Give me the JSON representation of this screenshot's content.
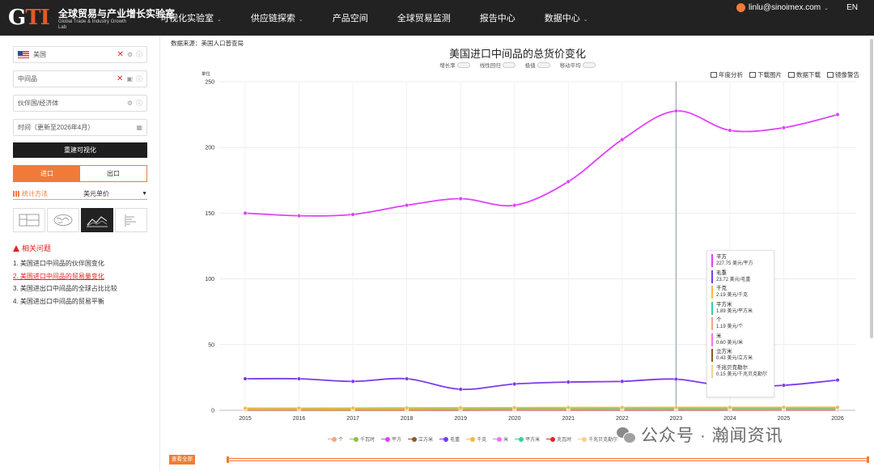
{
  "brand": {
    "mark": "GTI",
    "name_cn": "全球贸易与产业增长实验室",
    "name_en": "Global Trade & Industry Growth Lab"
  },
  "nav": [
    {
      "label": "可视化实验室",
      "caret": true
    },
    {
      "label": "供应链探索",
      "caret": true
    },
    {
      "label": "产品空间",
      "caret": false
    },
    {
      "label": "全球贸易监测",
      "caret": false
    },
    {
      "label": "报告中心",
      "caret": false
    },
    {
      "label": "数据中心",
      "caret": true
    }
  ],
  "user": {
    "email": "linlu@sinoimex.com",
    "lang": "EN"
  },
  "sidebar": {
    "country": "美国",
    "product": "中间品",
    "partner": "伙伴国/经济体",
    "time": "时间（更新至2026年4月）",
    "rebuild_label": "重建可视化",
    "trade_modes": [
      "进口",
      "出口"
    ],
    "stat_label": "统计方法",
    "stat_value": "美元单价",
    "related_title": "相关问题",
    "related": [
      "1. 美国进口中间品的伙伴国变化",
      "2. 美国进口中间品的贸易量变化",
      "3. 美国进出口中间品的全球占比比较",
      "4. 美国进出口中间品的贸易平衡"
    ],
    "related_highlight_index": 1
  },
  "main": {
    "source": "数据来源：美国人口普查局",
    "toggles": [
      "增长率",
      "线性回归",
      "极值",
      "移动平均"
    ],
    "tools": [
      "年度分析",
      "下载图片",
      "数据下载",
      "镜像警告"
    ],
    "view_all": "查看全部"
  },
  "tooltip": [
    {
      "name": "平方",
      "value": "227.75 美元/平方",
      "color": "#e040fb"
    },
    {
      "name": "毛重",
      "value": "23.72 美元/毛重",
      "color": "#7c3aed"
    },
    {
      "name": "千克",
      "value": "2.19 美元/千克",
      "color": "#f5b942"
    },
    {
      "name": "平方米",
      "value": "1.89 美元/平方米",
      "color": "#34d399"
    },
    {
      "name": "个",
      "value": "1.19 美元/个",
      "color": "#f4a582"
    },
    {
      "name": "米",
      "value": "0.60 美元/米",
      "color": "#f472f6"
    },
    {
      "name": "立方米",
      "value": "0.43 美元/立方米",
      "color": "#8b5a2b"
    },
    {
      "name": "千兆贝克勒尔",
      "value": "0.15 美元/千兆贝克勒尔",
      "color": "#f5d08a"
    }
  ],
  "chart_data": {
    "type": "line",
    "title": "美国进口中间品的总货价变化",
    "ylabel": "单位",
    "ylim": [
      0,
      250
    ],
    "yticks": [
      0,
      50,
      100,
      150,
      200,
      250
    ],
    "categories": [
      "2015",
      "2016",
      "2017",
      "2018",
      "2019",
      "2020",
      "2021",
      "2022",
      "2023",
      "2024",
      "2025",
      "2026"
    ],
    "highlight_category": "2023",
    "series": [
      {
        "name": "个",
        "color": "#f4a582",
        "values": [
          0.5,
          0.6,
          0.7,
          0.8,
          0.9,
          1.0,
          1.0,
          1.1,
          1.19,
          1.2,
          1.2,
          1.3
        ]
      },
      {
        "name": "千瓦时",
        "color": "#8bc34a",
        "values": [
          1.0,
          1.0,
          1.2,
          1.3,
          1.1,
          1.2,
          1.4,
          1.6,
          1.5,
          1.6,
          1.6,
          1.7
        ]
      },
      {
        "name": "平方",
        "color": "#e040fb",
        "values": [
          150,
          148,
          149,
          156,
          161,
          156,
          174,
          206,
          227.75,
          213,
          215,
          225
        ]
      },
      {
        "name": "立方米",
        "color": "#8b5a2b",
        "values": [
          0.3,
          0.3,
          0.3,
          0.35,
          0.35,
          0.4,
          0.4,
          0.42,
          0.43,
          0.44,
          0.45,
          0.46
        ]
      },
      {
        "name": "毛重",
        "color": "#7c3aed",
        "values": [
          24,
          24,
          22,
          24,
          16,
          20,
          21.5,
          22,
          23.72,
          18,
          19,
          23
        ]
      },
      {
        "name": "千克",
        "color": "#f5b942",
        "values": [
          1.5,
          1.6,
          1.7,
          1.8,
          1.9,
          2.0,
          2.1,
          2.15,
          2.19,
          2.2,
          2.25,
          2.3
        ]
      },
      {
        "name": "米",
        "color": "#f472f6",
        "values": [
          0.5,
          0.5,
          0.55,
          0.55,
          0.58,
          0.58,
          0.6,
          0.6,
          0.6,
          0.62,
          0.62,
          0.63
        ]
      },
      {
        "name": "平方米",
        "color": "#34d399",
        "values": [
          1.5,
          1.6,
          1.6,
          1.7,
          1.8,
          1.8,
          1.85,
          1.9,
          1.89,
          1.9,
          1.95,
          2.0
        ]
      },
      {
        "name": "兆瓦时",
        "color": "#dc2626",
        "values": [
          0.1,
          0.1,
          0.1,
          0.1,
          0.1,
          0.1,
          0.1,
          0.1,
          0.1,
          0.1,
          0.1,
          0.1
        ]
      },
      {
        "name": "千兆贝克勒尔",
        "color": "#f5d08a",
        "values": [
          0.12,
          0.12,
          0.13,
          0.13,
          0.14,
          0.14,
          0.14,
          0.15,
          0.15,
          0.15,
          0.15,
          0.15
        ]
      }
    ]
  },
  "watermark": "公众号 · 瀚闻资讯"
}
